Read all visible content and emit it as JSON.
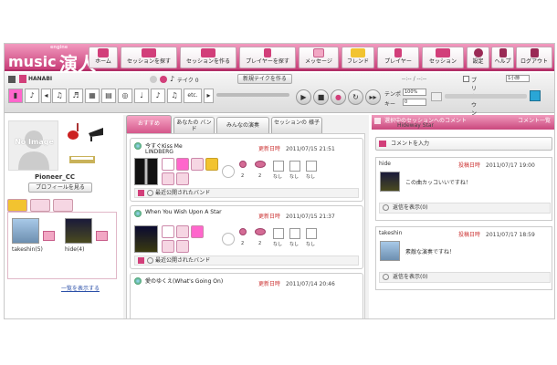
{
  "header": {
    "logo_small": "engine",
    "logo_main": "music",
    "logo_jp": "演人",
    "nav": [
      {
        "label": "ホーム",
        "icon": "home-icon"
      },
      {
        "label": "セッションを探す",
        "icon": "session-search-icon"
      },
      {
        "label": "セッションを作る",
        "icon": "session-create-icon"
      },
      {
        "label": "プレイヤーを探す",
        "icon": "player-search-icon"
      },
      {
        "label": "メッセージ",
        "icon": "message-icon"
      },
      {
        "label": "フレンド",
        "icon": "friend-icon"
      },
      {
        "label": "プレイヤー",
        "icon": "player-icon"
      },
      {
        "label": "セッション",
        "icon": "session-icon"
      },
      {
        "label": "設定",
        "icon": "gear-icon"
      },
      {
        "label": "ヘルプ",
        "icon": "help-icon"
      },
      {
        "label": "ログアウト",
        "icon": "logout-icon"
      }
    ]
  },
  "toolbar": {
    "session_name": "HANABI",
    "take_label": "テイク 0",
    "new_take_button": "新規テイクを作る",
    "time": "--:-- / --:--",
    "count_in_label": "プリカウント",
    "count_in_value": "1小節",
    "tempo_label": "テンポ",
    "tempo_value": "100%",
    "key_label": "キー",
    "key_value": "0",
    "etc_label": "etc."
  },
  "left": {
    "no_image": "No Image",
    "profile_name": "Pioneer_CC",
    "profile_button": "プロフィールを見る",
    "friends": [
      {
        "name": "takeshin(5)"
      },
      {
        "name": "hide(4)"
      }
    ],
    "see_all": "一覧を表示する"
  },
  "middle": {
    "tabs": [
      {
        "label": "おすすめ"
      },
      {
        "label": "あなたの バンド"
      },
      {
        "label": "みんなの演奏"
      },
      {
        "label": "セッションの 様子"
      }
    ],
    "cards": [
      {
        "title": "今すぐKiss Me",
        "artist": "LINDBERG",
        "date_label": "更新日時",
        "date": "2011/07/15 21:51",
        "stats": [
          "2",
          "2",
          "なし",
          "なし",
          "なし"
        ],
        "bottom": "最近公開されたバンド"
      },
      {
        "title": "When You Wish Upon A Star",
        "artist": "",
        "date_label": "更新日時",
        "date": "2011/07/15 21:37",
        "stats": [
          "2",
          "2",
          "なし",
          "なし",
          "なし"
        ],
        "bottom": "最近公開されたバンド"
      },
      {
        "title": "愛のゆくえ(What's Going On)",
        "artist": "",
        "date_label": "更新日時",
        "date": "2011/07/14 20:46"
      }
    ]
  },
  "right": {
    "header_title": "選択中のセッションへのコメント",
    "header_subtitle": "Hideway Star",
    "header_right": "コメント一覧",
    "comment_input": "コメントを入力",
    "comments": [
      {
        "user": "hide",
        "date_label": "投稿日時",
        "date": "2011/07/17 19:00",
        "text": "この曲カッコいいですね！",
        "replies": "返信を表示(0)"
      },
      {
        "user": "takeshin",
        "date_label": "投稿日時",
        "date": "2011/07/17 18:59",
        "text": "素敵な演奏ですね！",
        "replies": "返信を表示(0)"
      }
    ]
  },
  "colors": {
    "brand_pink": "#c93f79",
    "brand_light": "#f29abf",
    "date_red": "#cc3333",
    "link_blue": "#2a4fa8"
  }
}
